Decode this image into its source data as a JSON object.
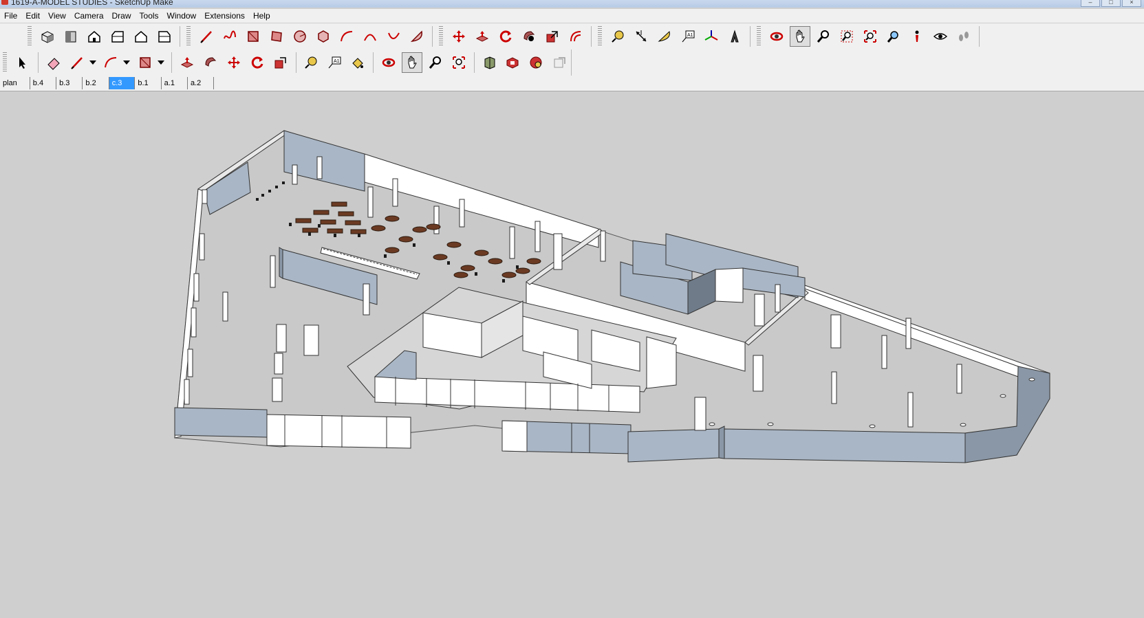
{
  "window": {
    "title": "1619-A-MODEL STUDIES - SketchUp Make"
  },
  "menu": [
    "File",
    "Edit",
    "View",
    "Camera",
    "Draw",
    "Tools",
    "Window",
    "Extensions",
    "Help"
  ],
  "toolbar_top": {
    "views": [
      "iso-view-icon",
      "top-view-icon",
      "front-view-icon",
      "right-view-icon",
      "back-view-icon",
      "left-view-icon"
    ],
    "drawing": [
      "line-icon",
      "freehand-icon",
      "rectangle-icon",
      "rotated-rectangle-icon",
      "circle-icon",
      "polygon-icon",
      "arc-icon",
      "two-point-arc-icon",
      "three-point-arc-icon",
      "pie-icon"
    ],
    "edit": [
      "move-icon",
      "push-pull-icon",
      "rotate-icon",
      "follow-me-icon",
      "scale-icon",
      "offset-icon"
    ],
    "construction": [
      "tape-measure-icon",
      "dimensions-icon",
      "protractor-icon",
      "text-icon",
      "axes-icon",
      "3d-text-icon"
    ],
    "camera": [
      "orbit-icon",
      "pan-icon",
      "zoom-icon",
      "zoom-window-icon",
      "zoom-extents-icon",
      "previous-view-icon",
      "position-camera-icon",
      "look-around-icon",
      "walk-icon"
    ]
  },
  "toolbar_bottom": {
    "principal": [
      "select-icon",
      "eraser-icon",
      "pencil-icon",
      "arc-icon",
      "shapes-icon",
      "push-pull-icon",
      "offset-icon",
      "move-icon",
      "rotate-icon",
      "scale-icon",
      "tape-measure-icon",
      "text-icon",
      "paint-bucket-icon",
      "orbit-icon",
      "pan-icon",
      "zoom-icon",
      "zoom-extents-icon",
      "3d-warehouse-icon",
      "extension-warehouse-icon",
      "layout-icon",
      "send-to-layout-icon"
    ]
  },
  "active_tool": "pan",
  "scenes": [
    "plan",
    "b.4",
    "b.3",
    "b.2",
    "c.3",
    "b.1",
    "a.1",
    "a.2"
  ],
  "active_scene": "c.3",
  "colors": {
    "viewport_bg": "#cfcfcf",
    "wall_face_light": "#ffffff",
    "wall_face_shaded": "#a9b6c5",
    "wall_face_dark": "#8a97a6",
    "floor": "#c9c9c9",
    "furniture": "#6b3a22",
    "active_scene_tab": "#3399ff"
  }
}
